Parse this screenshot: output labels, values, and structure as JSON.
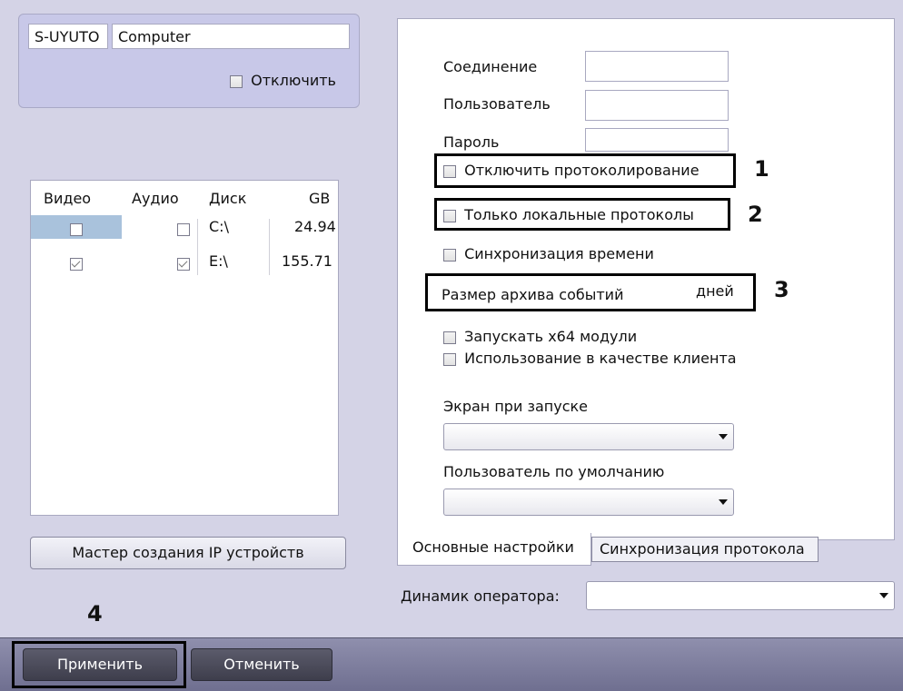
{
  "server": {
    "id": "S-UYUTO",
    "name": "Computer",
    "disable_label": "Отключить"
  },
  "disk_table": {
    "headers": [
      "Видео",
      "Аудио",
      "Диск",
      "GB"
    ],
    "rows": [
      {
        "video": false,
        "audio": false,
        "disk": "C:\\",
        "gb": "24.94"
      },
      {
        "video": true,
        "audio": true,
        "disk": "E:\\",
        "gb": "155.71"
      }
    ]
  },
  "ip_wizard_button": "Мастер создания IP устройств",
  "settings": {
    "connection_label": "Соединение",
    "user_label": "Пользователь",
    "password_label": "Пароль",
    "disable_logging_label": "Отключить протоколирование",
    "local_logs_label": "Только локальные протоколы",
    "time_sync_label": "Синхронизация времени",
    "archive_size_label": "Размер архива событий",
    "archive_days_unit": "дней",
    "x64_label": "Запускать x64 модули",
    "client_use_label": "Использование в качестве клиента",
    "start_screen_label": "Экран при запуске",
    "default_user_label": "Пользователь по умолчанию"
  },
  "tabs": [
    {
      "label": "Основные настройки",
      "active": true
    },
    {
      "label": "Синхронизация протокола",
      "active": false
    }
  ],
  "operator_speaker_label": "Динамик оператора:",
  "footer": {
    "apply_label": "Применить",
    "cancel_label": "Отменить"
  },
  "annotations": [
    "1",
    "2",
    "3",
    "4"
  ]
}
